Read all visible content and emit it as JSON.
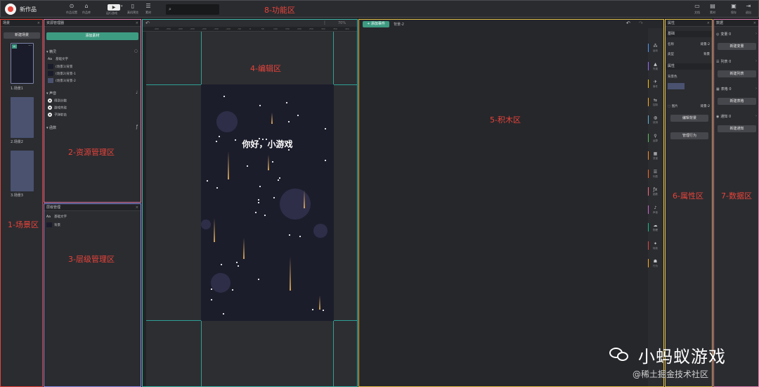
{
  "topbar": {
    "work_title": "新作品",
    "buttons": [
      {
        "icon": "pointer-icon",
        "glyph": "⊙",
        "label": "作品设置"
      },
      {
        "icon": "home-icon",
        "glyph": "⌂",
        "label": "作品库"
      },
      {
        "icon": "mobile-icon",
        "glyph": "▯",
        "label": "真机预览"
      },
      {
        "icon": "menu-icon",
        "glyph": "☰",
        "label": "素材"
      }
    ],
    "play_label": "运行游戏",
    "right_buttons": [
      {
        "icon": "book-icon",
        "glyph": "▭",
        "label": "文档"
      },
      {
        "icon": "bag-icon",
        "glyph": "▤",
        "label": "素材"
      },
      {
        "icon": "save-icon",
        "glyph": "▣",
        "label": "保存"
      },
      {
        "icon": "exit-icon",
        "glyph": "⇥",
        "label": "退出"
      }
    ]
  },
  "zones": {
    "scene": "1-场景区",
    "resource": "2-资源管理区",
    "layer": "3-层级管理区",
    "editor": "4-编辑区",
    "blocks": "5-积木区",
    "property": "6-属性区",
    "data": "7-数据区",
    "function": "8-功能区"
  },
  "scene": {
    "header": "场景",
    "new_button": "新建场景",
    "items": [
      {
        "label": "1.场景1"
      },
      {
        "label": "2.场景2"
      },
      {
        "label": "3.场景3"
      }
    ]
  },
  "resource": {
    "header": "资源管理器",
    "add_button": "添加素材",
    "sprite_section": "精灵",
    "sprites": [
      {
        "prefix": "Aa",
        "label": "基础文字"
      },
      {
        "prefix": "",
        "label": "(场景1)背景"
      },
      {
        "prefix": "",
        "label": "(场景2)背景-1"
      },
      {
        "prefix": "",
        "label": "(场景3)背景-2"
      }
    ],
    "sound_section": "声音",
    "sounds": [
      {
        "label": "得到分数"
      },
      {
        "label": "游戏失败"
      },
      {
        "label": "子弹射击"
      }
    ],
    "other_section": "函数"
  },
  "layer": {
    "header": "层级管理",
    "items": [
      {
        "prefix": "Aa",
        "label": "基础文字"
      },
      {
        "prefix": "",
        "label": "背景"
      }
    ]
  },
  "editor": {
    "zoom": "70%",
    "canvas_text": "你好，小游戏",
    "ruler_ticks": [
      "-400",
      "-350",
      "-300",
      "-250",
      "-200",
      "-150",
      "-100",
      "-50",
      "0",
      "50",
      "100",
      "150",
      "200",
      "250",
      "300",
      "350",
      "400",
      "450"
    ]
  },
  "blocks": {
    "add_event": "+ 添加事件",
    "scene_name": "背景-2",
    "tools": [
      {
        "icon": "motion-icon",
        "glyph": "⁂",
        "label": "运动",
        "color": "#4c97ff"
      },
      {
        "icon": "look-icon",
        "glyph": "▲",
        "label": "外观",
        "color": "#9966ff"
      },
      {
        "icon": "event-icon",
        "glyph": "✈",
        "label": "事件",
        "color": "#ffbf00"
      },
      {
        "icon": "control-icon",
        "glyph": "⇆",
        "label": "控制",
        "color": "#ffab19"
      },
      {
        "icon": "sensing-icon",
        "glyph": "◍",
        "label": "侦测",
        "color": "#5cb1d6"
      },
      {
        "icon": "operator-icon",
        "glyph": "⚲",
        "label": "运算",
        "color": "#59c059"
      },
      {
        "icon": "variable-icon",
        "glyph": "▦",
        "label": "变量",
        "color": "#ff8c1a"
      },
      {
        "icon": "list-icon",
        "glyph": "☰",
        "label": "列表",
        "color": "#ff661a"
      },
      {
        "icon": "function-icon",
        "glyph": "ƒx",
        "label": "函数",
        "color": "#ff6680"
      },
      {
        "icon": "sound-icon",
        "glyph": "♪",
        "label": "声音",
        "color": "#cf63cf"
      },
      {
        "icon": "physics-icon",
        "glyph": "☁",
        "label": "物理",
        "color": "#0fbd8c"
      },
      {
        "icon": "special-icon",
        "glyph": "✦",
        "label": "特效",
        "color": "#e8433a"
      },
      {
        "icon": "behavior-icon",
        "glyph": "☗",
        "label": "行为",
        "color": "#ffab19"
      }
    ]
  },
  "property": {
    "header": "属性",
    "basic_section": "基础",
    "name_label": "名称",
    "name_value": "背景-2",
    "type_label": "类型",
    "type_value": "背景",
    "attr_section": "属性",
    "bg_color_label": "背景色",
    "bg_color": "#4a5270",
    "image_label": "图片",
    "image_value": "背景-2",
    "edit_button": "编辑背景",
    "behavior_button": "管理行为"
  },
  "data": {
    "header": "数据",
    "sections": [
      {
        "icon": "variable-icon",
        "glyph": "◎",
        "label": "变量 0",
        "button": "新建变量"
      },
      {
        "icon": "list-icon",
        "glyph": "☰",
        "label": "列表 0",
        "button": "新建列表"
      },
      {
        "icon": "table-icon",
        "glyph": "▦",
        "label": "表格 0",
        "button": "新建表格"
      },
      {
        "icon": "notify-icon",
        "glyph": "◉",
        "label": "通知 0",
        "button": "新建通知"
      }
    ]
  },
  "watermark": {
    "title": "小蚂蚁游戏",
    "subtitle": "@稀土掘金技术社区"
  }
}
